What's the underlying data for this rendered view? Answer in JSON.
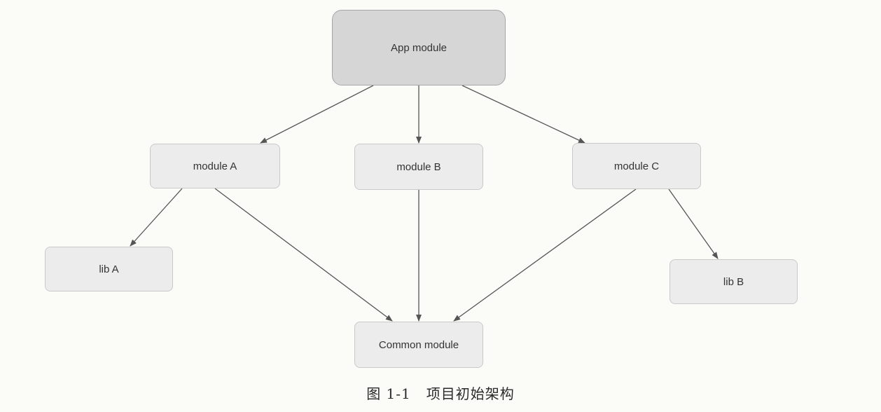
{
  "nodes": {
    "app": "App module",
    "module_a": "module A",
    "module_b": "module B",
    "module_c": "module C",
    "lib_a": "lib A",
    "lib_b": "lib B",
    "common": "Common module"
  },
  "edges": [
    {
      "from": "App module",
      "to": "module A"
    },
    {
      "from": "App module",
      "to": "module B"
    },
    {
      "from": "App module",
      "to": "module C"
    },
    {
      "from": "module A",
      "to": "lib A"
    },
    {
      "from": "module A",
      "to": "Common module"
    },
    {
      "from": "module B",
      "to": "Common module"
    },
    {
      "from": "module C",
      "to": "Common module"
    },
    {
      "from": "module C",
      "to": "lib B"
    }
  ],
  "caption": {
    "number": "图 1-1",
    "title": "项目初始架构"
  },
  "colors": {
    "root_fill": "#d6d6d6",
    "node_fill": "#ececec",
    "arrow": "#555555"
  }
}
